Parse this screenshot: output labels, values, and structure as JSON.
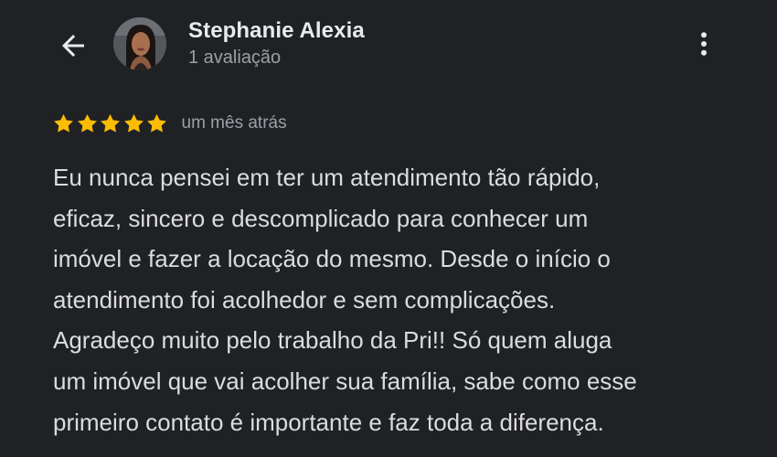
{
  "header": {
    "back_icon": "arrow-left-icon",
    "more_icon": "more-vertical-icon"
  },
  "reviewer": {
    "name": "Stephanie Alexia",
    "subtitle": "1 avaliação",
    "avatar_icon": "profile-photo"
  },
  "review": {
    "rating": 5,
    "max_rating": 5,
    "star_color": "#fbbc04",
    "time": "um mês atrás",
    "text_lines": [
      "Eu nunca pensei em ter um atendimento tão rápido,",
      "eficaz, sincero e descomplicado para conhecer um",
      "imóvel e fazer a locação do mesmo. Desde o início o",
      "atendimento foi acolhedor e sem complicações.",
      "Agradeço muito pelo trabalho da Pri!! Só quem aluga",
      "um imóvel que vai acolher sua família, sabe como esse",
      "primeiro contato é importante e faz toda a diferença."
    ]
  },
  "colors": {
    "background": "#202124",
    "primary_text": "#e8eaed",
    "secondary_text": "#9aa0a6"
  }
}
